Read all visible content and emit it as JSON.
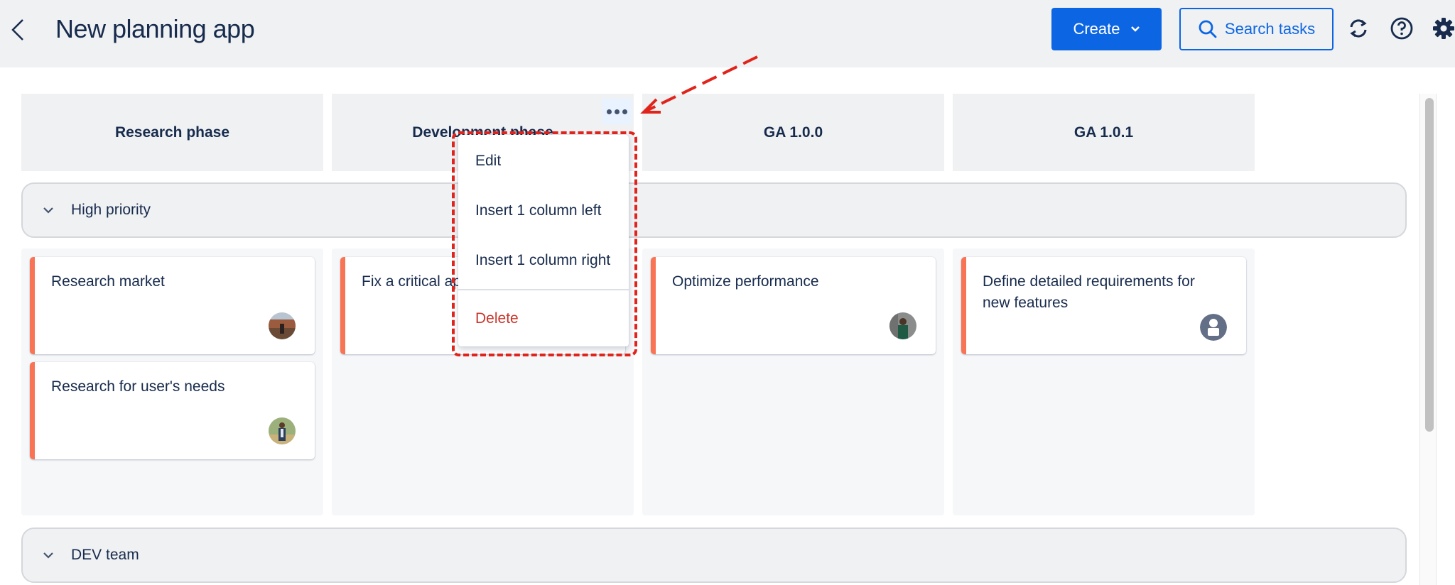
{
  "header": {
    "title": "New planning app",
    "create_label": "Create",
    "search_label": "Search tasks",
    "icons": [
      "back-arrow-icon",
      "chevron-down-icon",
      "search-icon",
      "sync-icon",
      "help-icon",
      "gear-icon"
    ]
  },
  "columns": [
    {
      "title": "Research phase"
    },
    {
      "title": "Development phase"
    },
    {
      "title": "GA 1.0.0"
    },
    {
      "title": "GA 1.0.1"
    }
  ],
  "swimlanes": [
    {
      "label": "High priority",
      "expanded": true,
      "cards": [
        {
          "column": 0,
          "title": "Research market",
          "avatar": "photo"
        },
        {
          "column": 0,
          "title": "Research for user's needs",
          "avatar": "photo"
        },
        {
          "column": 1,
          "title": "Fix a critical ap",
          "avatar": "hidden"
        },
        {
          "column": 2,
          "title": "Optimize performance",
          "avatar": "photo"
        },
        {
          "column": 3,
          "title": "Define detailed requirements for new features",
          "avatar": "default-user"
        }
      ]
    },
    {
      "label": "DEV team",
      "expanded": true
    }
  ],
  "column_menu": {
    "target_column": "Development phase",
    "items": [
      {
        "label": "Edit"
      },
      {
        "label": "Insert 1 column left"
      },
      {
        "label": "Insert 1 column right"
      },
      {
        "label": "Delete",
        "danger": true
      }
    ]
  },
  "colors": {
    "primary": "#0c66e4",
    "card_accent": "#f87455",
    "danger": "#c9372c",
    "annotation": "#e0241c"
  }
}
